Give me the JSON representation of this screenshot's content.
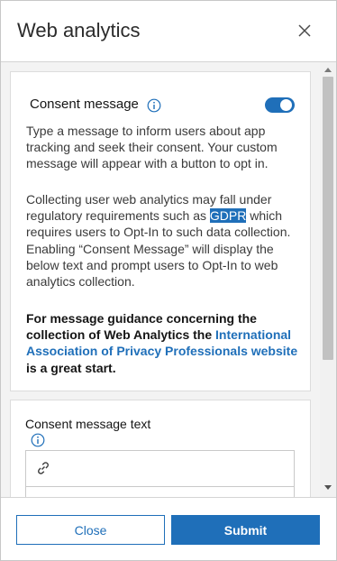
{
  "dialog": {
    "title": "Web analytics",
    "close_icon": "close-icon"
  },
  "consent": {
    "label": "Consent message",
    "info_icon": "info-icon",
    "toggle_on": true,
    "paragraph1": "Type a message to inform users about app tracking and seek their consent. Your custom message will appear with a button to opt in.",
    "paragraph2_before": "Collecting user web analytics may fall under regulatory requirements such as ",
    "paragraph2_highlight": "GDPR",
    "paragraph2_after": " which requires users to Opt-In to such data collection. Enabling “Consent Message” will display the below text and prompt users to Opt-In to web analytics collection.",
    "guidance_before": "For message guidance concerning the collection of Web Analytics the ",
    "guidance_link": "International Association of Privacy Professionals website",
    "guidance_after": " is a great start."
  },
  "message_text": {
    "label": "Consent message text",
    "info_icon": "info-icon",
    "toolbar_icon": "link-icon"
  },
  "footer": {
    "close_label": "Close",
    "submit_label": "Submit"
  },
  "colors": {
    "accent": "#1f6fb9",
    "background": "#f3f3f3"
  }
}
